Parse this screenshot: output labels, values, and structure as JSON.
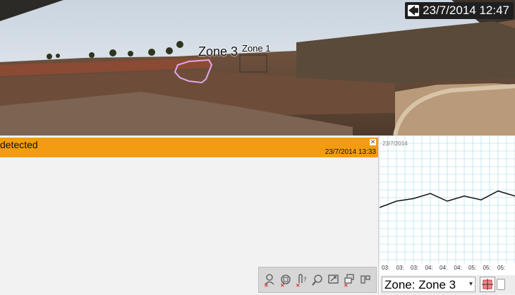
{
  "camera": {
    "timestamp": "23/7/2014 12:47",
    "back_icon": "back-arrow-icon",
    "zones": [
      {
        "label": "Zone 3",
        "color": "#e0a8e8"
      },
      {
        "label": "Zone 1",
        "color": "#333333"
      }
    ]
  },
  "alert": {
    "title": "detected",
    "time": "23/7/2014 13:33",
    "close_icon": "close-icon",
    "bar_color": "#f39c12"
  },
  "toolbar": {
    "buttons": [
      "remove-person-icon",
      "remove-motion-icon",
      "remove-audio-icon",
      "search-icon",
      "export-icon",
      "remove-group-icon",
      "layout-icon"
    ]
  },
  "chart": {
    "date": "23/7/2014",
    "ticks": [
      "03:",
      "03:",
      "03:",
      "04:",
      "04:",
      "04:",
      "05:",
      "05:",
      "05:"
    ],
    "chart_data": {
      "type": "line",
      "x": [
        "03:",
        "03:",
        "03:",
        "04:",
        "04:",
        "04:",
        "05:",
        "05:",
        "05:"
      ],
      "series": [
        {
          "values": [
            0.45,
            0.4,
            0.38,
            0.34,
            0.4,
            0.36,
            0.39,
            0.32,
            0.36
          ]
        }
      ],
      "grid": true
    }
  },
  "controls": {
    "zone_select": "Zone: Zone 3",
    "tool_icon": "zone-tool-icon"
  }
}
